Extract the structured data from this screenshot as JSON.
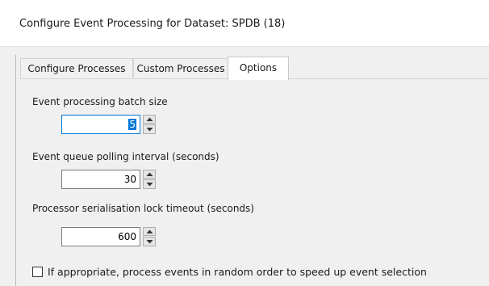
{
  "window": {
    "title": "Configure Event Processing for Dataset: SPDB (18)"
  },
  "tabs": [
    {
      "label": "Configure Processes",
      "active": false
    },
    {
      "label": "Custom Processes",
      "active": false
    },
    {
      "label": "Options",
      "active": true
    }
  ],
  "options": {
    "batch_size": {
      "label": "Event processing batch size",
      "value": "5"
    },
    "polling_interval": {
      "label": "Event queue polling interval (seconds)",
      "value": "30"
    },
    "lock_timeout": {
      "label": "Processor serialisation lock timeout (seconds)",
      "value": "600"
    },
    "random_order": {
      "label": "If appropriate, process events in random order to speed up event selection",
      "checked": false
    }
  },
  "colors": {
    "accent": "#0078d7",
    "window_bg": "#f0f0f0",
    "titlebar_bg": "#ffffff"
  },
  "icons": {
    "spin_up": "up-arrow-icon",
    "spin_down": "down-arrow-icon"
  }
}
